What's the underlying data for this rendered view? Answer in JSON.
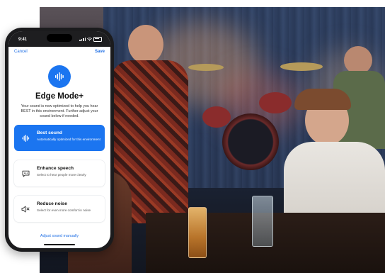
{
  "status_bar": {
    "time": "9:41"
  },
  "nav": {
    "cancel_label": "Cancel",
    "save_label": "Save"
  },
  "header": {
    "icon": "waveform-icon",
    "title": "Edge Mode+",
    "description": "Your sound is now optimized to help you hear BEST in this environment. Further adjust your sound below if needed."
  },
  "options": [
    {
      "icon": "waveform-icon",
      "title": "Best sound",
      "subtitle": "Automatically optimized for this environment",
      "selected": true
    },
    {
      "icon": "speech-bubble-icon",
      "title": "Enhance speech",
      "subtitle": "Select to hear people more clearly",
      "selected": false
    },
    {
      "icon": "speaker-reduce-icon",
      "title": "Reduce noise",
      "subtitle": "Select for even more comfort in noise",
      "selected": false
    }
  ],
  "footer": {
    "link_label": "Adjust sound manually"
  },
  "colors": {
    "accent": "#1b75f0",
    "link": "#1f6fe5"
  }
}
